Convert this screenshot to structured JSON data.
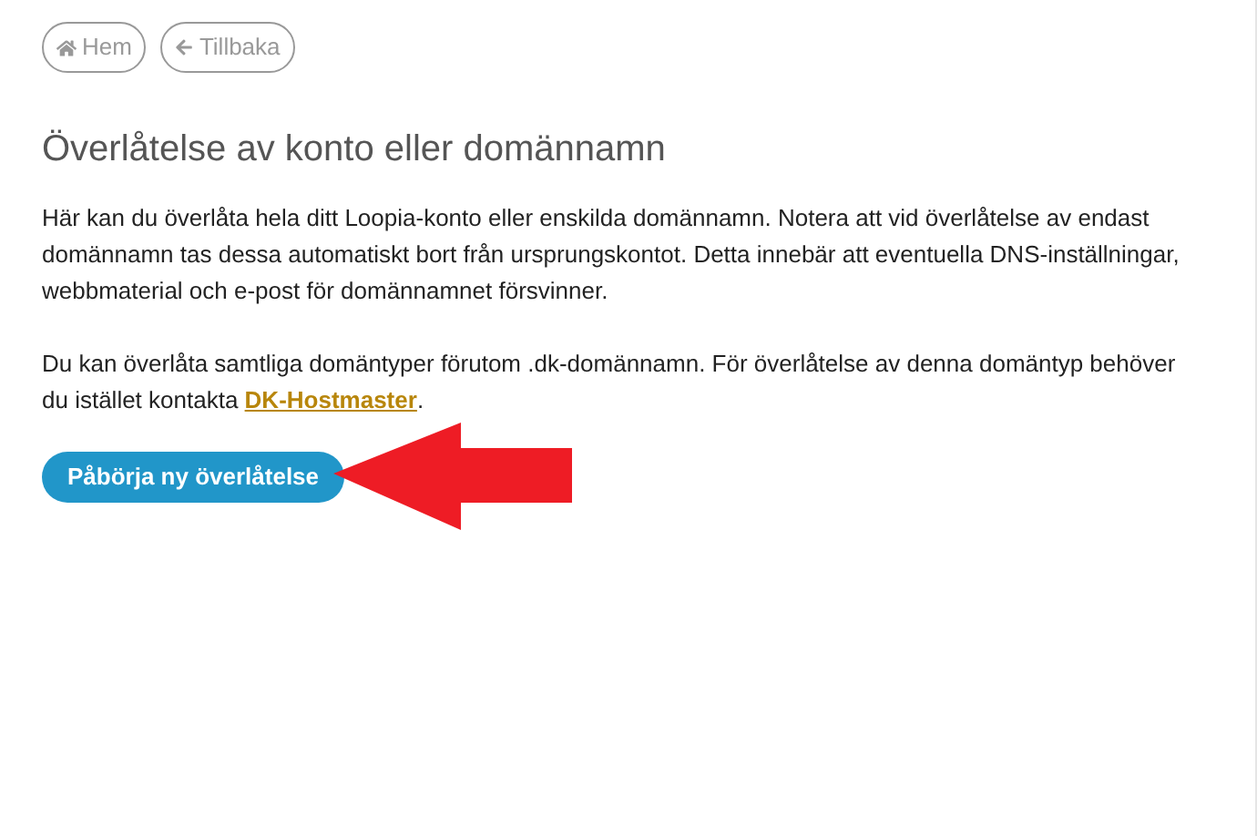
{
  "nav_buttons": [
    {
      "kind": "home",
      "label": "Hem"
    },
    {
      "kind": "back",
      "label": "Tillbaka"
    }
  ],
  "heading": "Överlåtelse av konto eller domännamn",
  "paragraph_1": "Här kan du överlåta hela ditt Loopia-konto eller enskilda domännamn. Notera att vid överlåtelse av endast domännamn tas dessa automatiskt bort från ursprungskontot. Detta innebär att eventuella DNS-inställningar, webbmaterial och e-post för domännamnet försvinner.",
  "paragraph_2": {
    "text": "Du kan överlåta samtliga domäntyper förutom .dk-domännamn. För överlåtelse av denna domäntyp behöver du istället kontakta ",
    "link": "DK-Hostmaster",
    "end": "."
  },
  "primary_button": "Påbörja ny överlåtelse"
}
